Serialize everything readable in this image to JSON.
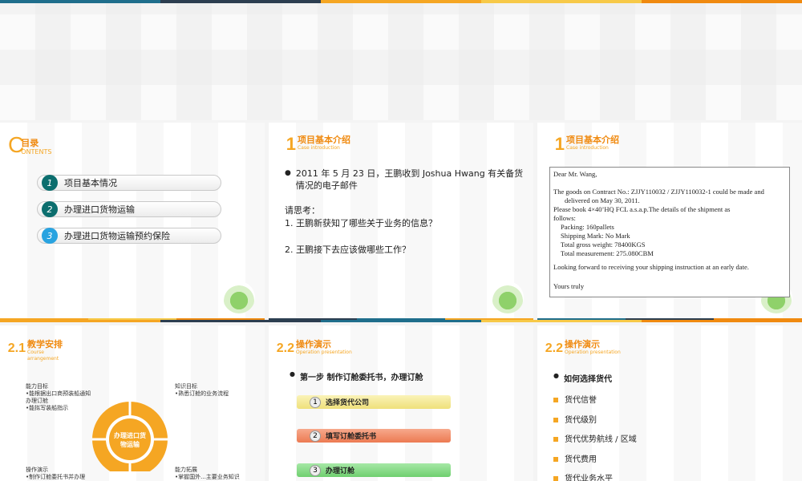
{
  "colors": {
    "orange": "#f5a623",
    "dark_orange": "#f08a10",
    "teal": "#0c6e6e",
    "blue": "#29a3e0",
    "yellow": "#f7e98a",
    "red": "#f08060",
    "green": "#7fd47f",
    "navy": "#1f4e79"
  },
  "toc": {
    "letter": "C",
    "title": "目录",
    "subtitle": "ONTENTS",
    "items": [
      {
        "num": "1",
        "label": "项目基本情况"
      },
      {
        "num": "2",
        "label": "办理进口货物运输"
      },
      {
        "num": "3",
        "label": "办理进口货物运输预约保险"
      }
    ]
  },
  "intro1": {
    "num": "1",
    "title": "项目基本介绍",
    "subtitle": "Case introduction",
    "bullet": "2011 年 5 月 23 日，王鹏收到 Joshua Hwang 有关备货情况的电子邮件",
    "think_label": "请思考：",
    "q1": "1. 王鹏新获知了哪些关于业务的信息？",
    "q2": "2. 王鹏接下去应该做哪些工作？"
  },
  "intro2": {
    "num": "1",
    "title": "项目基本介绍",
    "subtitle": "Case introduction",
    "email": {
      "greeting": "Dear Mr. Wang,",
      "line1": "The goods on Contract No.: ZJJY110032 / ZJJY110032-1 could be made and",
      "line1b": "delivered on May 30, 2011.",
      "line2": "Please book 4×40’HQ FCL a.s.a.p.The details of the shipment as",
      "line2b": "follows:",
      "packing": "Packing: 160pallets",
      "mark": "Shipping Mark: No Mark",
      "weight": "Total gross weight: 78400KGS",
      "measure": "Total measurement: 275.080CBM",
      "closing": "Looking forward to receiving your shipping instruction at an early date.",
      "sign": "Yours truly"
    }
  },
  "arrange": {
    "num": "2.1",
    "title": "教学安排",
    "subtitle1": "Course",
    "subtitle2": "arrangement",
    "center1": "办理进口货",
    "center2": "物运输",
    "tl_head": "能力目标",
    "tl_1": "•能根据出口商预装船通知",
    "tl_2": "办理订舱",
    "tl_3": "•能拟写装船指示",
    "tr_head": "知识目标",
    "tr_1": "•熟悉订舱的业务流程",
    "bl_head": "操作演示",
    "bl_1": "•制作订舱委托书并办理",
    "br_head": "能力拓展",
    "br_1": "•掌握国外...主要业务知识"
  },
  "demo1": {
    "num": "2.2",
    "title": "操作演示",
    "subtitle": "Operation presentation",
    "step_title": "第一步  制作订舱委托书，办理订舱",
    "steps": [
      {
        "num": "1",
        "label": "选择货代公司"
      },
      {
        "num": "2",
        "label": "填写订舱委托书"
      },
      {
        "num": "3",
        "label": "办理订舱"
      }
    ]
  },
  "demo2": {
    "num": "2.2",
    "title": "操作演示",
    "subtitle": "Operation presentation",
    "heading": "如何选择货代",
    "items": [
      "货代信誉",
      "货代级别",
      "货代优势航线 / 区域",
      "货代费用",
      "货代业务水平"
    ]
  }
}
